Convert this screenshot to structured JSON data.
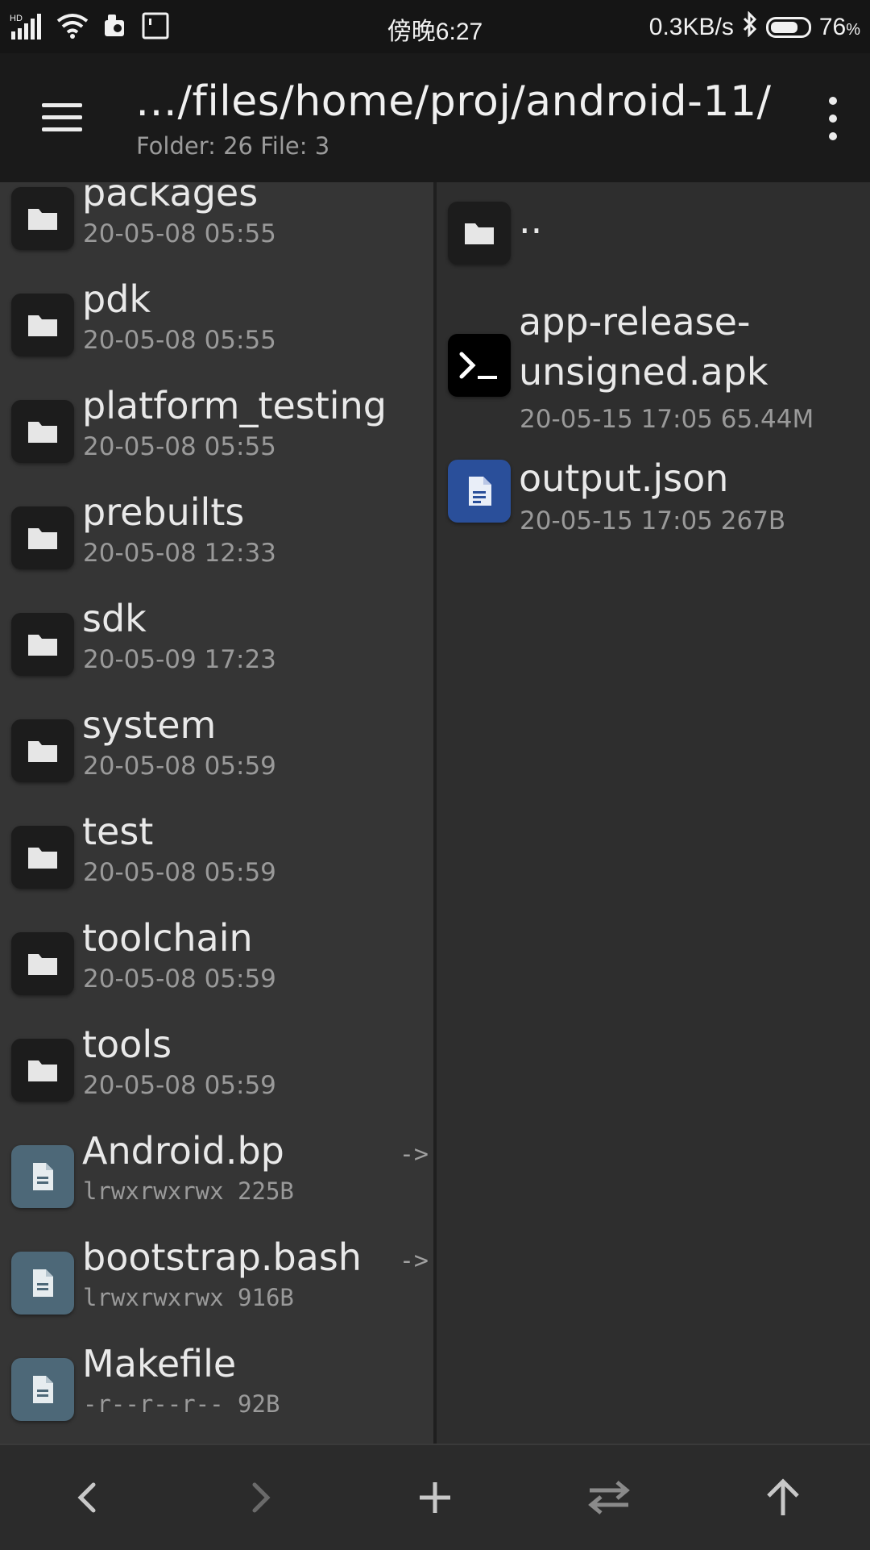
{
  "status_bar": {
    "network_label": "HD",
    "time": "傍晚6:27",
    "speed": "0.3KB/s",
    "battery_level": 76,
    "battery_value": "76",
    "battery_unit": "%"
  },
  "toolbar": {
    "path": "…/files/home/proj/android-11/",
    "counts": "Folder: 26  File: 3"
  },
  "left_pane": {
    "items": [
      {
        "name": "packages",
        "meta": "20-05-08 05:55",
        "type": "folder"
      },
      {
        "name": "pdk",
        "meta": "20-05-08 05:55",
        "type": "folder"
      },
      {
        "name": "platform_testing",
        "meta": "20-05-08 05:55",
        "type": "folder"
      },
      {
        "name": "prebuilts",
        "meta": "20-05-08 12:33",
        "type": "folder"
      },
      {
        "name": "sdk",
        "meta": "20-05-09 17:23",
        "type": "folder"
      },
      {
        "name": "system",
        "meta": "20-05-08 05:59",
        "type": "folder"
      },
      {
        "name": "test",
        "meta": "20-05-08 05:59",
        "type": "folder"
      },
      {
        "name": "toolchain",
        "meta": "20-05-08 05:59",
        "type": "folder"
      },
      {
        "name": "tools",
        "meta": "20-05-08 05:59",
        "type": "folder"
      },
      {
        "name": "Android.bp",
        "meta": "lrwxrwxrwx 225B",
        "type": "file",
        "symlink": "->"
      },
      {
        "name": "bootstrap.bash",
        "meta": "lrwxrwxrwx 916B",
        "type": "file",
        "symlink": "->"
      },
      {
        "name": "Makefile",
        "meta": "-r--r--r-- 92B",
        "type": "file"
      }
    ]
  },
  "right_pane": {
    "parent": "..",
    "items": [
      {
        "name_line1": "app-release-",
        "name_line2": "unsigned.apk",
        "meta": "20-05-15 17:05  65.44M",
        "type": "apk"
      },
      {
        "name": "output.json",
        "meta": "20-05-15 17:05  267B",
        "type": "json"
      }
    ]
  },
  "bottom_bar": {
    "buttons": [
      "back-icon",
      "forward-icon",
      "add-icon",
      "swap-icon",
      "up-icon"
    ]
  }
}
